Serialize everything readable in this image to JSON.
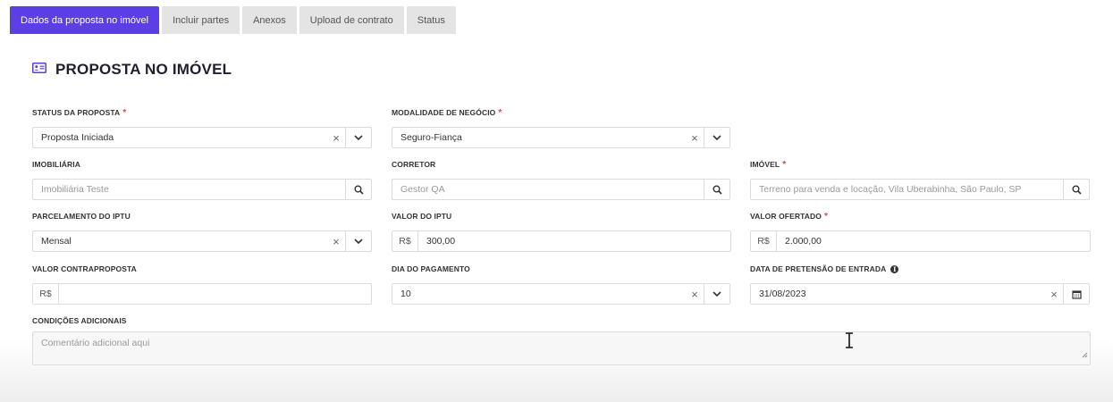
{
  "tabs": [
    {
      "label": "Dados da proposta no imóvel",
      "active": true
    },
    {
      "label": "Incluir partes",
      "active": false
    },
    {
      "label": "Anexos",
      "active": false
    },
    {
      "label": "Upload de contrato",
      "active": false
    },
    {
      "label": "Status",
      "active": false
    }
  ],
  "page": {
    "title": "PROPOSTA NO IMÓVEL",
    "title_icon": "id-card-icon"
  },
  "fields": {
    "status_proposta": {
      "label": "STATUS DA PROPOSTA",
      "required": "*",
      "value": "Proposta Iniciada"
    },
    "modalidade": {
      "label": "MODALIDADE DE NEGÓCIO",
      "required": "*",
      "value": "Seguro-Fiança"
    },
    "imobiliaria": {
      "label": "IMOBILIÁRIA",
      "placeholder": "Imobiliária Teste"
    },
    "corretor": {
      "label": "CORRETOR",
      "placeholder": "Gestor QA"
    },
    "imovel": {
      "label": "IMÓVEL",
      "required": "*",
      "placeholder": "Terreno para venda e locação, Vila Uberabinha, São Paulo, SP"
    },
    "parcelamento_iptu": {
      "label": "PARCELAMENTO DO IPTU",
      "value": "Mensal"
    },
    "valor_iptu": {
      "label": "VALOR DO IPTU",
      "prefix": "R$",
      "value": "300,00"
    },
    "valor_ofertado": {
      "label": "VALOR OFERTADO",
      "required": "*",
      "prefix": "R$",
      "value": "2.000,00"
    },
    "valor_contraproposta": {
      "label": "VALOR CONTRAPROPOSTA",
      "prefix": "R$",
      "value": ""
    },
    "dia_pagamento": {
      "label": "DIA DO PAGAMENTO",
      "value": "10"
    },
    "data_pretensao": {
      "label": "DATA DE PRETENSÃO DE ENTRADA",
      "info_icon": "i",
      "value": "31/08/2023"
    },
    "condicoes": {
      "label": "CONDIÇÕES ADICIONAIS",
      "placeholder": "Comentário adicional aqui"
    }
  },
  "colors": {
    "accent": "#5b3ee6",
    "required": "#e04545"
  }
}
